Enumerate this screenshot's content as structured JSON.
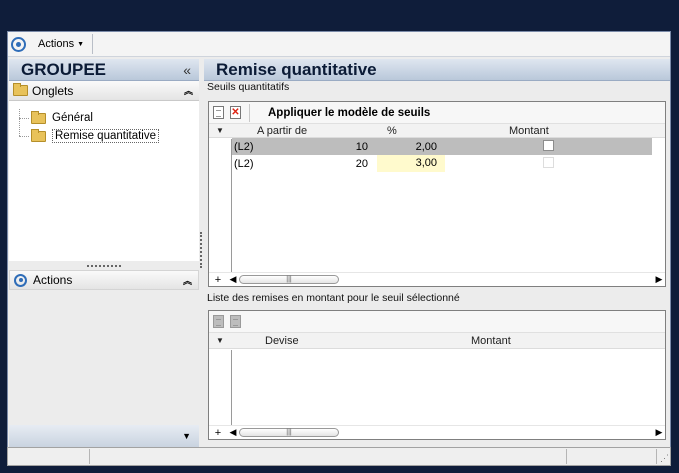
{
  "toolbar": {
    "actions_label": "Actions"
  },
  "left": {
    "title": "GROUPEE",
    "collapse_glyph": "«",
    "onglets_label": "Onglets",
    "tabs": [
      {
        "label": "Général"
      },
      {
        "label": "Remise quantitative"
      }
    ],
    "actions_label": "Actions"
  },
  "main": {
    "title": "Remise quantitative",
    "thresholds_label": "Seuils quantitatifs",
    "apply_model_label": "Appliquer le modèle de seuils",
    "columns": {
      "from": "A partir de",
      "percent": "%",
      "amount": "Montant"
    },
    "rows": [
      {
        "code": "(L2)",
        "from": "10",
        "percent": "2,00",
        "amount": false
      },
      {
        "code": "(L2)",
        "from": "20",
        "percent": "3,00",
        "amount": false
      }
    ],
    "amount_list_label": "Liste des remises en montant pour le seuil sélectionné",
    "amount_columns": {
      "currency": "Devise",
      "amount": "Montant"
    }
  },
  "icons": [
    "app-circle-icon",
    "folder-icon",
    "document-icon",
    "delete-icon",
    "chevron-up-icon",
    "chevron-down-icon"
  ],
  "colors": {
    "header_bg": "#c3d0e1",
    "selected_row": "#bdbdbd",
    "edited_cell": "#fffacd",
    "accent": "#2f6db8"
  }
}
